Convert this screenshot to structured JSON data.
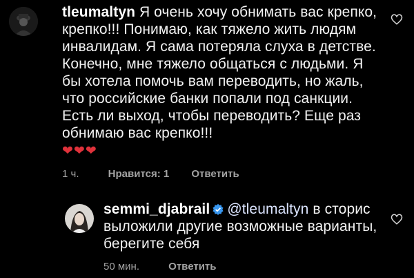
{
  "comments": [
    {
      "username": "tleumaltyn",
      "text": "Я очень хочу обнимать вас крепко, крепко!!! Понимаю, как тяжело жить людям инвалидам. Я сама потеряла слуха в детстве. Конечно, мне тяжело общаться с людьми. Я бы хотела помочь вам переводить, но жаль, что российские банки попали под санкции. Есть ли выход, чтобы переводить? Еще раз обнимаю вас крепко!!!",
      "hearts": "❤❤❤",
      "time": "1 ч.",
      "likes": "Нравится: 1",
      "reply": "Ответить"
    },
    {
      "username": "semmi_djabrail",
      "mention": "@tleumaltyn",
      "text": "в сторис выложили другие возможные варианты, берегите себя",
      "time": "50 мин.",
      "reply": "Ответить"
    }
  ],
  "colors": {
    "background": "#000000",
    "text": "#f2f2f2",
    "meta": "#a3a3a3",
    "heart": "#e0323b",
    "verified": "#3897f0"
  },
  "icons": [
    "avatar",
    "verified-badge-icon",
    "heart-outline-icon"
  ]
}
